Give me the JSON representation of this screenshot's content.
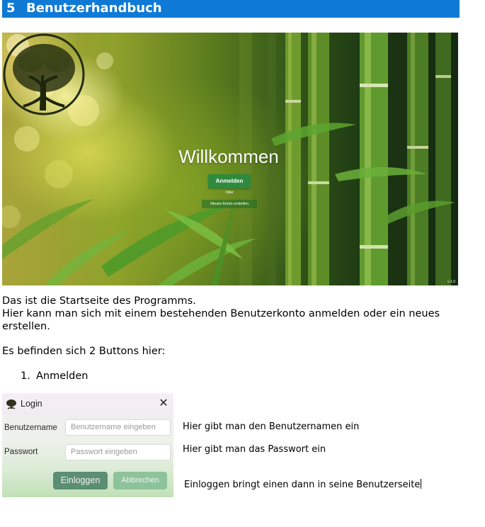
{
  "heading": {
    "number": "5",
    "title": "Benutzerhandbuch"
  },
  "welcome_screen": {
    "title": "Willkommen",
    "login_button": "Anmelden",
    "or_text": "Oder",
    "create_account_link": "Neues Konto erstellen",
    "version": "v 1.0"
  },
  "intro": {
    "line1": "Das ist die Startseite des Programms.",
    "line2": "Hier kann man sich mit einem bestehenden Benutzerkonto anmelden oder ein neues",
    "line3": "erstellen.",
    "buttons_intro": "Es befinden sich 2 Buttons hier:"
  },
  "list": {
    "item1_number": "1.",
    "item1_text": "Anmelden"
  },
  "login_dialog": {
    "title": "Login",
    "close_glyph": "✕",
    "username_label": "Benutzername",
    "username_placeholder": "Benutzername eingeben",
    "password_label": "Passwort",
    "password_placeholder": "Passwort eingeben",
    "login_button": "Einloggen",
    "cancel_button": "Abbrechen"
  },
  "notes": {
    "username": "Hier gibt man den Benutzernamen ein",
    "password": "Hier gibt man das Passwort ein",
    "login": "Einloggen bringt einen dann in seine Benutzerseite"
  },
  "colors": {
    "heading_bg": "#0f7ad6",
    "accent_green": "#2e8a3d",
    "login_button": "#5b8e73",
    "cancel_button": "#8dc39a"
  }
}
